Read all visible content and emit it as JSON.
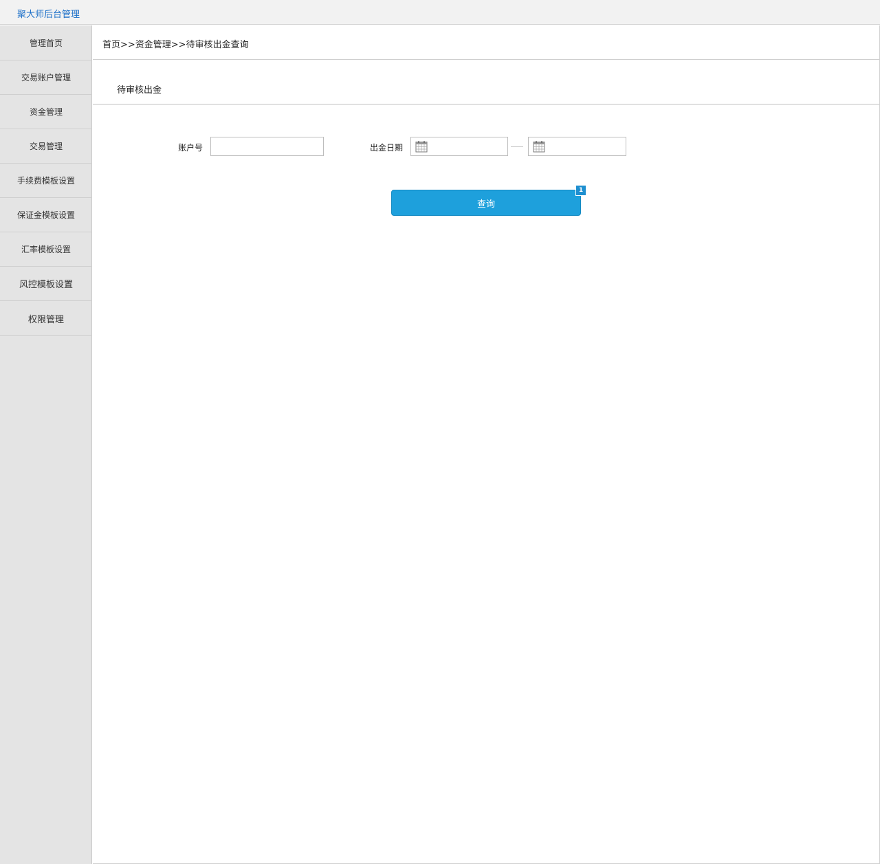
{
  "app": {
    "title": "聚大师后台管理"
  },
  "sidebar": {
    "items": [
      {
        "label": "管理首页"
      },
      {
        "label": "交易账户管理"
      },
      {
        "label": "资金管理"
      },
      {
        "label": "交易管理"
      },
      {
        "label": "手续费模板设置"
      },
      {
        "label": "保证金模板设置"
      },
      {
        "label": "汇率模板设置"
      },
      {
        "label": "风控模板设置"
      },
      {
        "label": "权限管理"
      }
    ]
  },
  "main": {
    "breadcrumb": "首页>>资金管理>>待审核出金查询",
    "section_title": "待审核出金",
    "form": {
      "account_label": "账户号",
      "account_value": "",
      "date_label": "出金日期",
      "date_start": "",
      "date_end": "",
      "calendar_icon": "calendar-icon"
    },
    "query_button": "查询",
    "badge": "1"
  },
  "colors": {
    "brand_title": "#1a6ec8",
    "button": "#1ea0dc",
    "badge": "#1e8fd0",
    "sidebar_bg": "#e4e4e4"
  }
}
